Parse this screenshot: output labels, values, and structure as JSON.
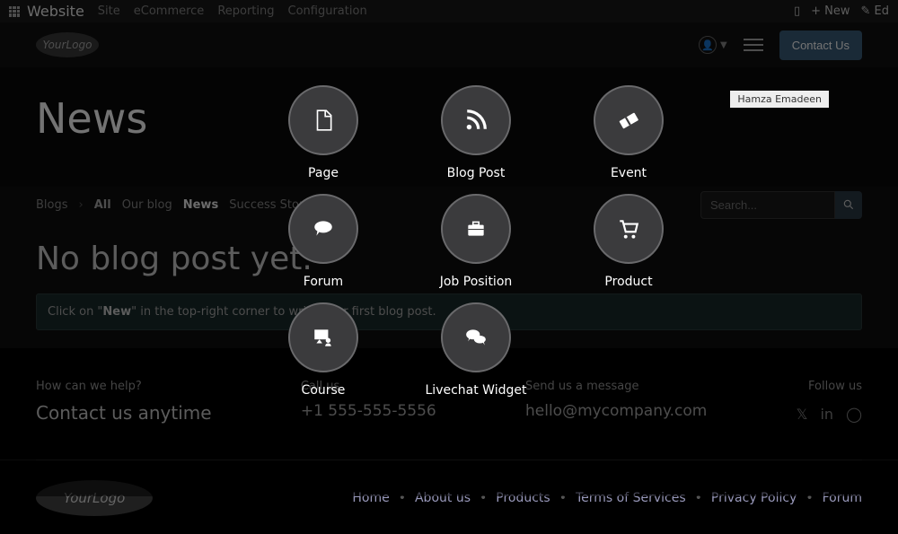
{
  "topbar": {
    "brand": "Website",
    "nav": [
      "Site",
      "eCommerce",
      "Reporting",
      "Configuration"
    ],
    "new": "New",
    "edit": "Ed"
  },
  "header": {
    "logo": "YourLogo",
    "contact": "Contact Us"
  },
  "hero": {
    "title": "News"
  },
  "subnav": {
    "root": "Blogs",
    "items": [
      "All",
      "Our blog",
      "News",
      "Success Stories"
    ],
    "active": "News"
  },
  "search": {
    "placeholder": "Search..."
  },
  "content": {
    "heading": "No blog post yet.",
    "hint_pre": "Click on \"",
    "hint_bold": "New",
    "hint_post": "\" in the top-right corner to write your first blog post."
  },
  "footer": {
    "help_q": "How can we help?",
    "help_a": "Contact us anytime",
    "call_lbl": "Call us",
    "phone": "+1 555-555-5556",
    "msg_lbl": "Send us a message",
    "email": "hello@mycompany.com",
    "follow": "Follow us",
    "logo": "YourLogo",
    "links": [
      "Home",
      "About us",
      "Products",
      "Terms of Services",
      "Privacy Policy",
      "Forum"
    ]
  },
  "tooltip": "Hamza Emadeen",
  "newmenu": [
    {
      "name": "page",
      "label": "Page"
    },
    {
      "name": "blog-post",
      "label": "Blog Post"
    },
    {
      "name": "event",
      "label": "Event"
    },
    {
      "name": "forum",
      "label": "Forum"
    },
    {
      "name": "job-position",
      "label": "Job Position"
    },
    {
      "name": "product",
      "label": "Product"
    },
    {
      "name": "course",
      "label": "Course"
    },
    {
      "name": "livechat-widget",
      "label": "Livechat Widget"
    }
  ]
}
